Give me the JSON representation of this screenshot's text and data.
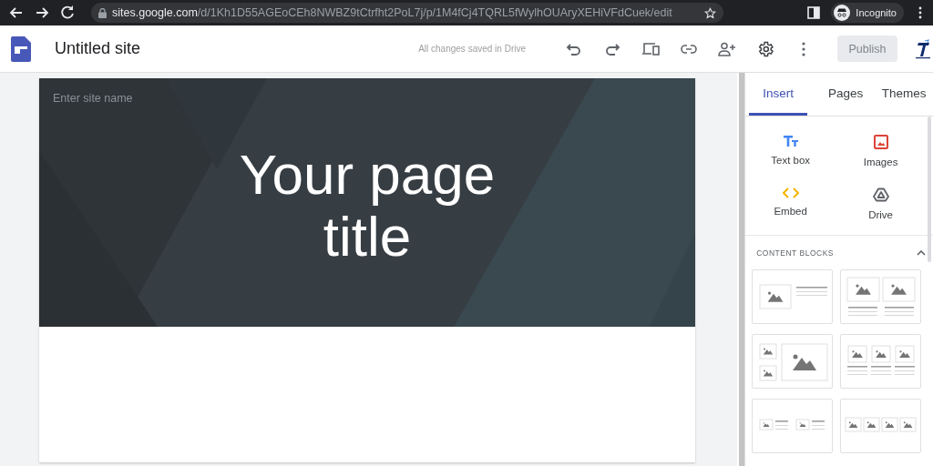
{
  "browser": {
    "url_host": "sites.google.com",
    "url_path": "/d/1Kh1D55AGEoCEh8NWBZ9tCtrfht2PoL7j/p/1M4fCj4TQRL5fWylhOUAryXEHiVFdCuek/edit",
    "profile": "Incognito"
  },
  "app_bar": {
    "title": "Untitled site",
    "status": "All changes saved in Drive",
    "publish": {
      "label": "Publish",
      "disabled": true
    }
  },
  "page": {
    "site_name_placeholder": "Enter site name",
    "title": "Your page title"
  },
  "panel": {
    "tabs": [
      {
        "label": "Insert",
        "selected": true
      },
      {
        "label": "Pages",
        "selected": false
      },
      {
        "label": "Themes",
        "selected": false
      }
    ],
    "insert_items": [
      {
        "label": "Text box",
        "kind": "text"
      },
      {
        "label": "Images",
        "kind": "image"
      },
      {
        "label": "Embed",
        "kind": "embed"
      },
      {
        "label": "Drive",
        "kind": "drive"
      }
    ],
    "content_blocks": {
      "heading": "CONTENT BLOCKS",
      "expanded": true,
      "blocks": [
        {
          "kind": "image-text"
        },
        {
          "kind": "two-images"
        },
        {
          "kind": "collage"
        },
        {
          "kind": "three-images"
        },
        {
          "kind": "image-text-pairs"
        },
        {
          "kind": "four-images"
        }
      ]
    }
  }
}
